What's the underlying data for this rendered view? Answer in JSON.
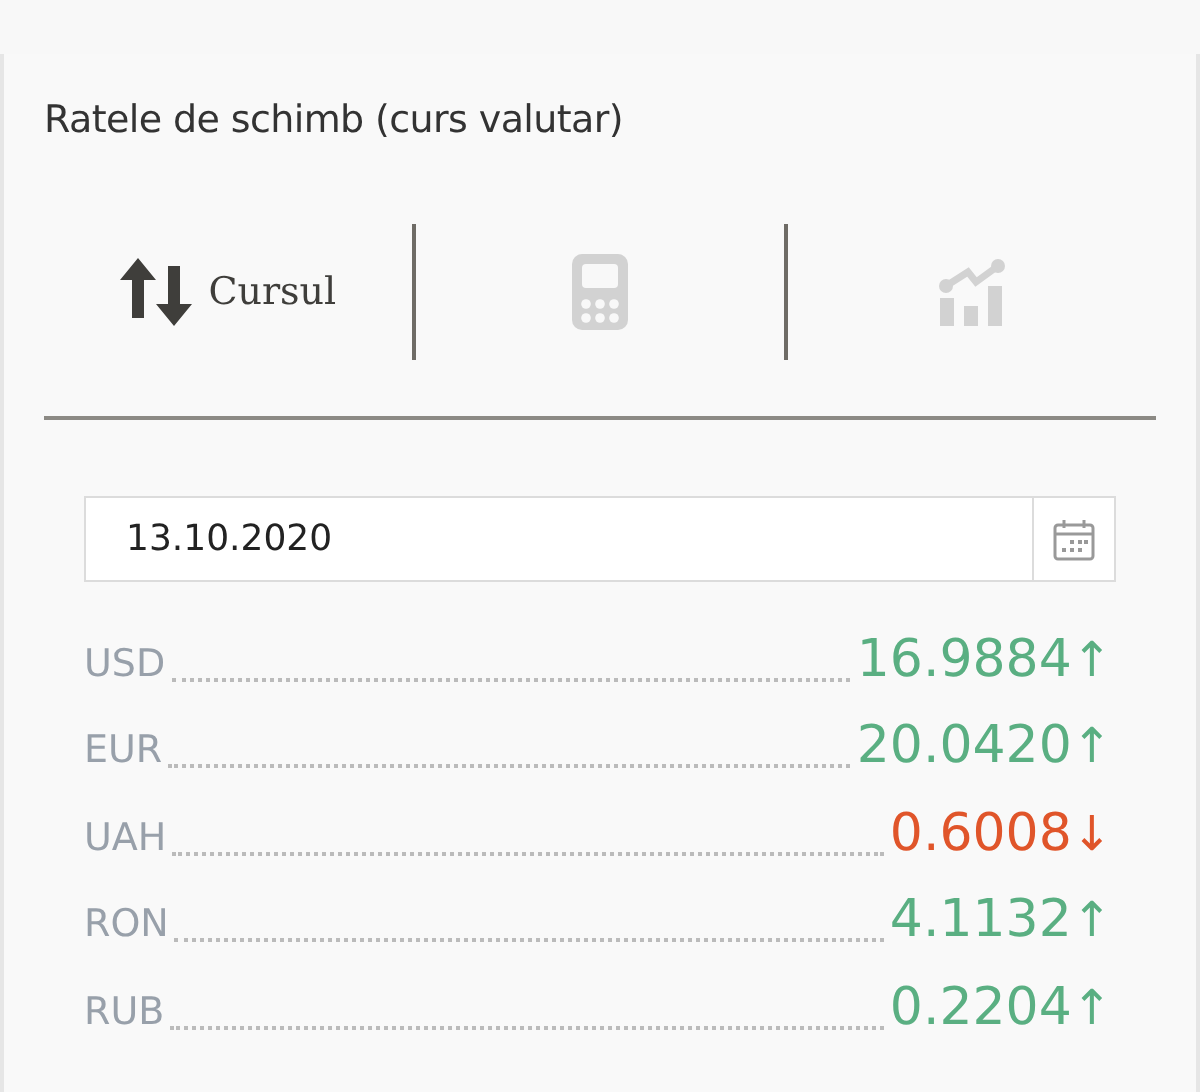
{
  "title": "Ratele de schimb (curs valutar)",
  "tabs": [
    {
      "kind": "rates",
      "label": "Cursul",
      "selected": true
    },
    {
      "kind": "calculator",
      "selected": false
    },
    {
      "kind": "chart",
      "selected": false
    }
  ],
  "date_field": {
    "value": "13.10.2020"
  },
  "rates": [
    {
      "currency": "USD",
      "value": "16.9884",
      "arrow": "↑",
      "rising": true
    },
    {
      "currency": "EUR",
      "value": "20.0420",
      "arrow": "↑",
      "rising": true
    },
    {
      "currency": "UAH",
      "value": "0.6008",
      "arrow": "↓",
      "rising": false
    },
    {
      "currency": "RON",
      "value": "4.1132",
      "arrow": "↑",
      "rising": true
    },
    {
      "currency": "RUB",
      "value": "0.2204",
      "arrow": "↑",
      "rising": true
    }
  ]
}
